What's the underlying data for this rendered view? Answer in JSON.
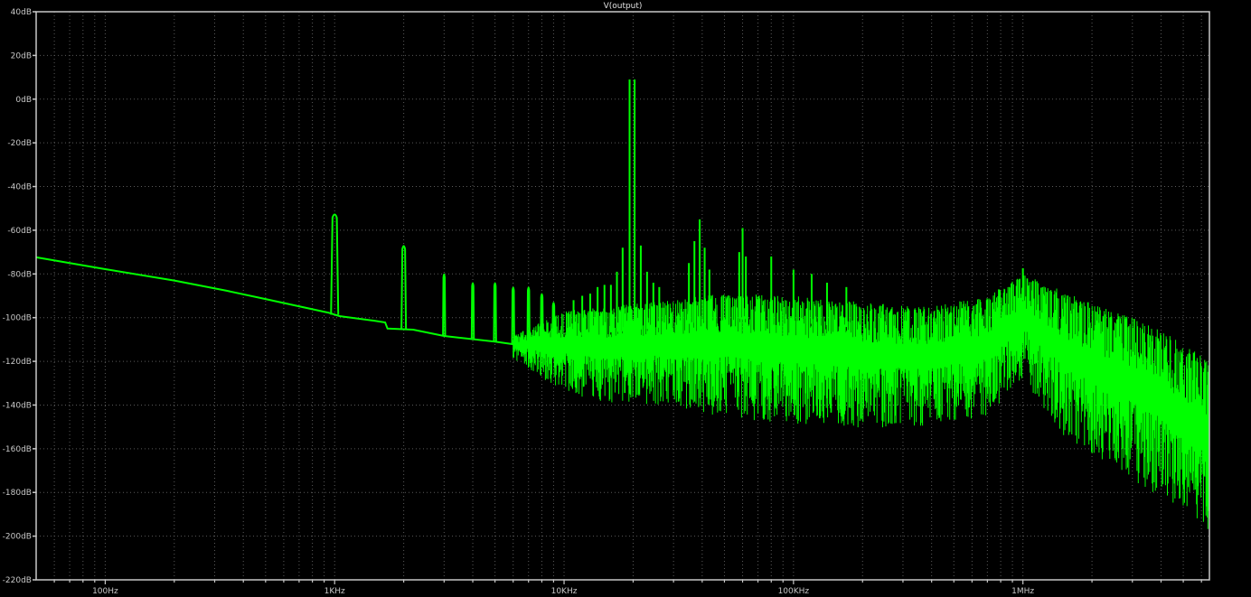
{
  "chart_data": {
    "type": "line",
    "title": "V(output)",
    "x_scale": "log",
    "xlim": [
      50,
      6500000
    ],
    "ylim": [
      -220,
      40
    ],
    "grid": true,
    "colors": {
      "background": "#000000",
      "trace": "#00ff00",
      "axis": "#c8c8c8",
      "grid": "#5a5a5a"
    },
    "x_ticks": [
      {
        "value": 100,
        "label": "100Hz"
      },
      {
        "value": 1000,
        "label": "1KHz"
      },
      {
        "value": 10000,
        "label": "10KHz"
      },
      {
        "value": 100000,
        "label": "100KHz"
      },
      {
        "value": 1000000,
        "label": "1MHz"
      }
    ],
    "y_ticks": [
      {
        "value": 40,
        "label": "40dB"
      },
      {
        "value": 20,
        "label": "20dB"
      },
      {
        "value": 0,
        "label": "0dB"
      },
      {
        "value": -20,
        "label": "-20dB"
      },
      {
        "value": -40,
        "label": "-40dB"
      },
      {
        "value": -60,
        "label": "-60dB"
      },
      {
        "value": -80,
        "label": "-80dB"
      },
      {
        "value": -100,
        "label": "-100dB"
      },
      {
        "value": -120,
        "label": "-120dB"
      },
      {
        "value": -140,
        "label": "-140dB"
      },
      {
        "value": -160,
        "label": "-160dB"
      },
      {
        "value": -180,
        "label": "-180dB"
      },
      {
        "value": -200,
        "label": "-200dB"
      },
      {
        "value": -220,
        "label": "-220dB"
      }
    ],
    "low_freq_trace": [
      [
        50,
        -72.4
      ],
      [
        100,
        -77.8
      ],
      [
        200,
        -83
      ],
      [
        338,
        -87.7
      ],
      [
        500,
        -91.5
      ],
      [
        936,
        -97.7
      ],
      [
        1050,
        -99.3
      ],
      [
        1500,
        -101.5
      ],
      [
        1660,
        -102.2
      ],
      [
        1700,
        -105
      ],
      [
        2200,
        -105.5
      ],
      [
        3000,
        -108.4
      ],
      [
        5000,
        -111
      ],
      [
        8000,
        -114
      ],
      [
        10000,
        -117
      ]
    ],
    "harmonics": [
      [
        1000,
        -52.6
      ],
      [
        2000,
        -67
      ],
      [
        3000,
        -80
      ],
      [
        4000,
        -84
      ],
      [
        5000,
        -84
      ],
      [
        6000,
        -86
      ],
      [
        7000,
        -86
      ],
      [
        8000,
        -89
      ],
      [
        9000,
        -93
      ]
    ],
    "noise_band": {
      "upper": [
        [
          6000,
          -108
        ],
        [
          10000,
          -97
        ],
        [
          15000,
          -95
        ],
        [
          30000,
          -92
        ],
        [
          50000,
          -88
        ],
        [
          100000,
          -90
        ],
        [
          200000,
          -93
        ],
        [
          400000,
          -95
        ],
        [
          700000,
          -90
        ],
        [
          1000000,
          -80
        ],
        [
          1500000,
          -88
        ],
        [
          2000000,
          -93
        ],
        [
          3000000,
          -100
        ],
        [
          4000000,
          -106
        ],
        [
          5000000,
          -112
        ],
        [
          6500000,
          -120
        ]
      ],
      "lower": [
        [
          6000,
          -118
        ],
        [
          10000,
          -132
        ],
        [
          15000,
          -136
        ],
        [
          30000,
          -138
        ],
        [
          50000,
          -142
        ],
        [
          100000,
          -145
        ],
        [
          200000,
          -147
        ],
        [
          400000,
          -146
        ],
        [
          700000,
          -142
        ],
        [
          1000000,
          -125
        ],
        [
          1500000,
          -150
        ],
        [
          2000000,
          -158
        ],
        [
          3000000,
          -170
        ],
        [
          4000000,
          -178
        ],
        [
          5000000,
          -184
        ],
        [
          6500000,
          -195
        ]
      ]
    },
    "spurs": [
      [
        11000,
        -92
      ],
      [
        12000,
        -90
      ],
      [
        13000,
        -89
      ],
      [
        14000,
        -86
      ],
      [
        15000,
        -85
      ],
      [
        16000,
        -85
      ],
      [
        17000,
        -79
      ],
      [
        18000,
        -68
      ],
      [
        19300,
        9
      ],
      [
        20300,
        9
      ],
      [
        21600,
        -67
      ],
      [
        23000,
        -79
      ],
      [
        24500,
        -84
      ],
      [
        26000,
        -86
      ],
      [
        35000,
        -75
      ],
      [
        37000,
        -65
      ],
      [
        39000,
        -55
      ],
      [
        41000,
        -68
      ],
      [
        43000,
        -78
      ],
      [
        58000,
        -70
      ],
      [
        60000,
        -59
      ],
      [
        62000,
        -72
      ],
      [
        80000,
        -72
      ],
      [
        100000,
        -78
      ],
      [
        120000,
        -80
      ],
      [
        140000,
        -84
      ],
      [
        170000,
        -86
      ],
      [
        1000000,
        -77.4
      ]
    ]
  }
}
